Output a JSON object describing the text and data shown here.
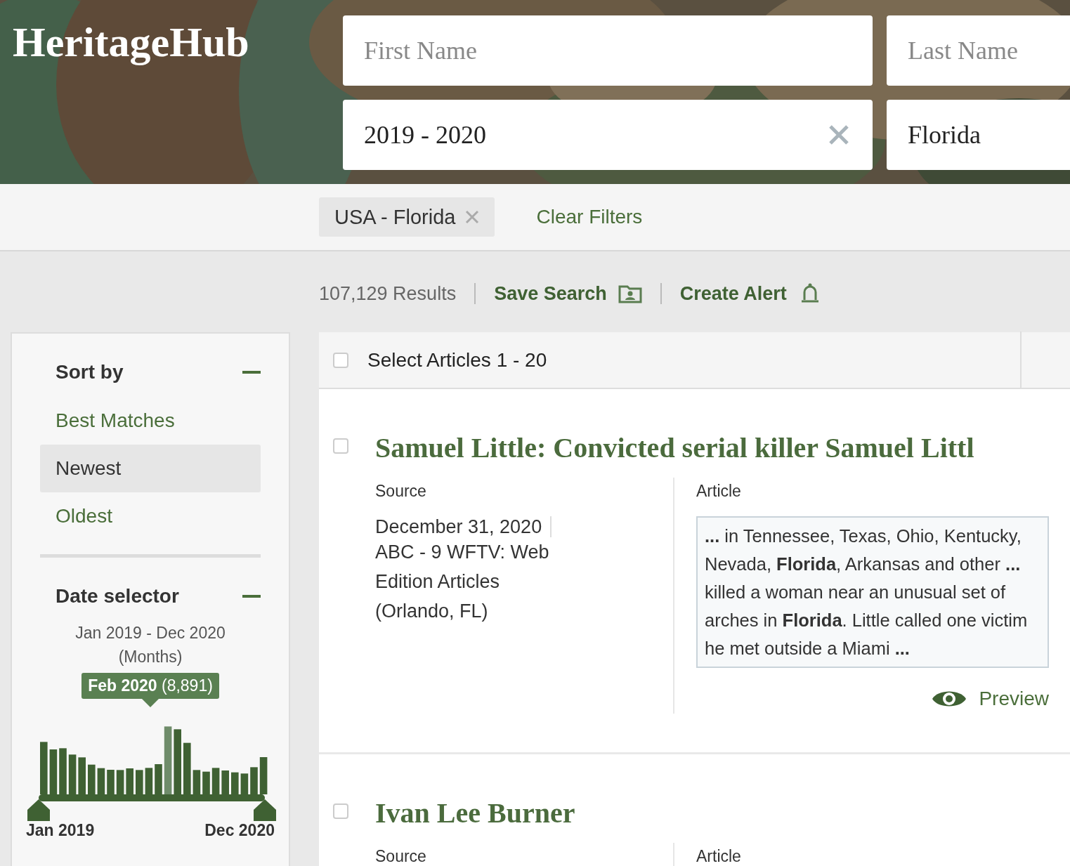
{
  "brand": "HeritageHub",
  "search": {
    "fields": [
      {
        "placeholder": "First Name"
      },
      {
        "placeholder": "Last Name"
      },
      {
        "value": "2019 - 2020",
        "clearable": true
      },
      {
        "value": "Florida",
        "clearable": false
      }
    ]
  },
  "filters": {
    "chips": [
      {
        "label": "USA - Florida"
      }
    ],
    "clear_link": "Clear Filters"
  },
  "results": {
    "count": "107,129 Results",
    "save_search": "Save Search",
    "create_alert": "Create Alert"
  },
  "sidebar": {
    "sort": {
      "title": "Sort by",
      "expanded": true,
      "options": [
        {
          "label": "Best Matches",
          "selected": false
        },
        {
          "label": "Newest",
          "selected": true
        },
        {
          "label": "Oldest",
          "selected": false
        }
      ]
    },
    "date": {
      "title": "Date selector",
      "expanded": true,
      "range": "Jan 2019 - Dec 2020",
      "unit": "(Months)",
      "tooltip": "**Feb 2020** (8,891)",
      "level": 1,
      "start_label": "Jan 2019",
      "end_label": "Dec 2020"
    }
  },
  "list": {
    "select_label": "Select Articles 1 - 20",
    "select_checked": false,
    "articles": [
      {
        "checked": false,
        "title": "Samuel Little: Convicted serial killer Samuel Littl",
        "source_label": "Source",
        "date": "December 31, 2020",
        "publication": "ABC - 9 WFTV: Web Edition Articles (Orlando, FL)",
        "article_label": "Article",
        "snippet": "**...** in Tennessee, Texas, Ohio, Kentucky, Nevada, **Florida**, Arkansas and other **...** killed a woman near an unusual set of arches in **Florida**. Little called one victim he met outside a Miami **...**",
        "preview": "Preview"
      },
      {
        "checked": false,
        "title": "Ivan Lee Burner",
        "source_label": "Source",
        "article_label": "Article"
      }
    ]
  }
}
